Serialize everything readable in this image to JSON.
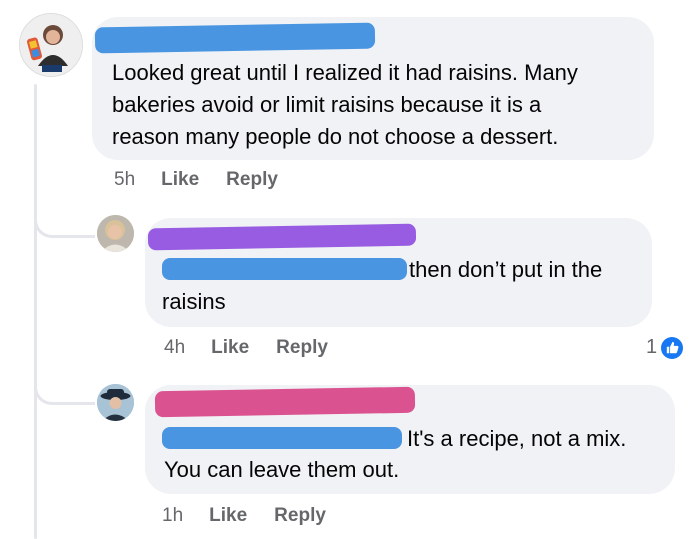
{
  "colors": {
    "bubble": "#f0f2f5",
    "meta_text": "#65676b",
    "like_blue": "#1877f2",
    "redact_blue": "#3b8de0",
    "redact_purple": "#8f4fe0",
    "redact_pink": "#d94487"
  },
  "comments": [
    {
      "text": "Looked great until I realized it had raisins.  Many\nbakeries avoid or limit raisins because it is a\nreason many people do not choose a dessert.",
      "time": "5h",
      "like_label": "Like",
      "reply_label": "Reply",
      "avatar": "profile-photo-icon"
    },
    {
      "text_tail": "then don’t put in the",
      "text_line2": "raisins",
      "time": "4h",
      "like_label": "Like",
      "reply_label": "Reply",
      "reaction_count": "1",
      "reaction_icon": "thumbs-up-icon",
      "avatar": "profile-photo-icon"
    },
    {
      "text_tail": "It's a recipe, not a mix.",
      "text_line2": "You can leave them out.",
      "time": "1h",
      "like_label": "Like",
      "reply_label": "Reply",
      "avatar": "profile-photo-icon"
    }
  ]
}
